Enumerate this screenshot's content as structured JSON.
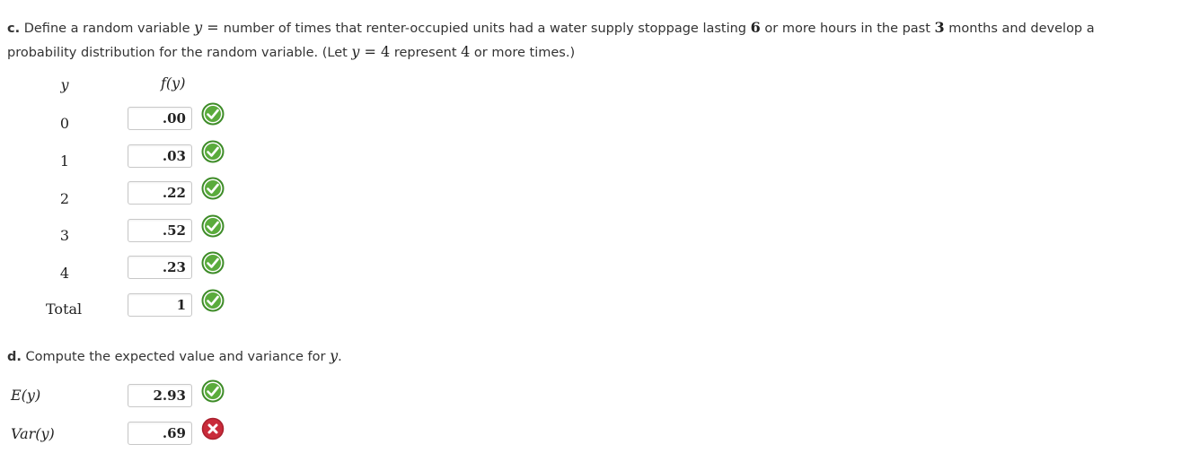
{
  "part_c": {
    "letter": "c.",
    "text1": " Define a random variable ",
    "var": "y",
    "eq": " = ",
    "text2": " number of times that renter-occupied units had a water supply stoppage lasting ",
    "hours": "6",
    "text3": " or more hours in the past ",
    "months": "3",
    "text4": " months and develop a",
    "text5": "probability distribution for the random variable. (Let ",
    "let_var": "y",
    "let_eq": " = ",
    "let_val": "4",
    "text6": " represent ",
    "rep_val": "4",
    "text7": " or more times.)"
  },
  "table": {
    "col_y": "y",
    "col_fy": "f(y)",
    "rows": [
      {
        "y": "0",
        "fy": ".00",
        "status": "correct"
      },
      {
        "y": "1",
        "fy": ".03",
        "status": "correct"
      },
      {
        "y": "2",
        "fy": ".22",
        "status": "correct"
      },
      {
        "y": "3",
        "fy": ".52",
        "status": "correct"
      },
      {
        "y": "4",
        "fy": ".23",
        "status": "correct"
      }
    ],
    "total_label": "Total",
    "total_value": "1",
    "total_status": "correct"
  },
  "part_d": {
    "letter": "d.",
    "text": " Compute the expected value and variance for ",
    "var": "y",
    "end": ".",
    "ey_label": "E(y)",
    "ey_value": "2.93",
    "ey_status": "correct",
    "var_label": "Var(y)",
    "var_value": ".69",
    "var_status": "incorrect"
  },
  "colors": {
    "correct_fill": "#5aab3c",
    "correct_border": "#3e8c28",
    "incorrect_fill": "#c92b3a",
    "input_border": "#c8c8c8",
    "text": "#333333"
  },
  "icons": {
    "correct": "check-circle-icon",
    "incorrect": "x-circle-icon"
  }
}
